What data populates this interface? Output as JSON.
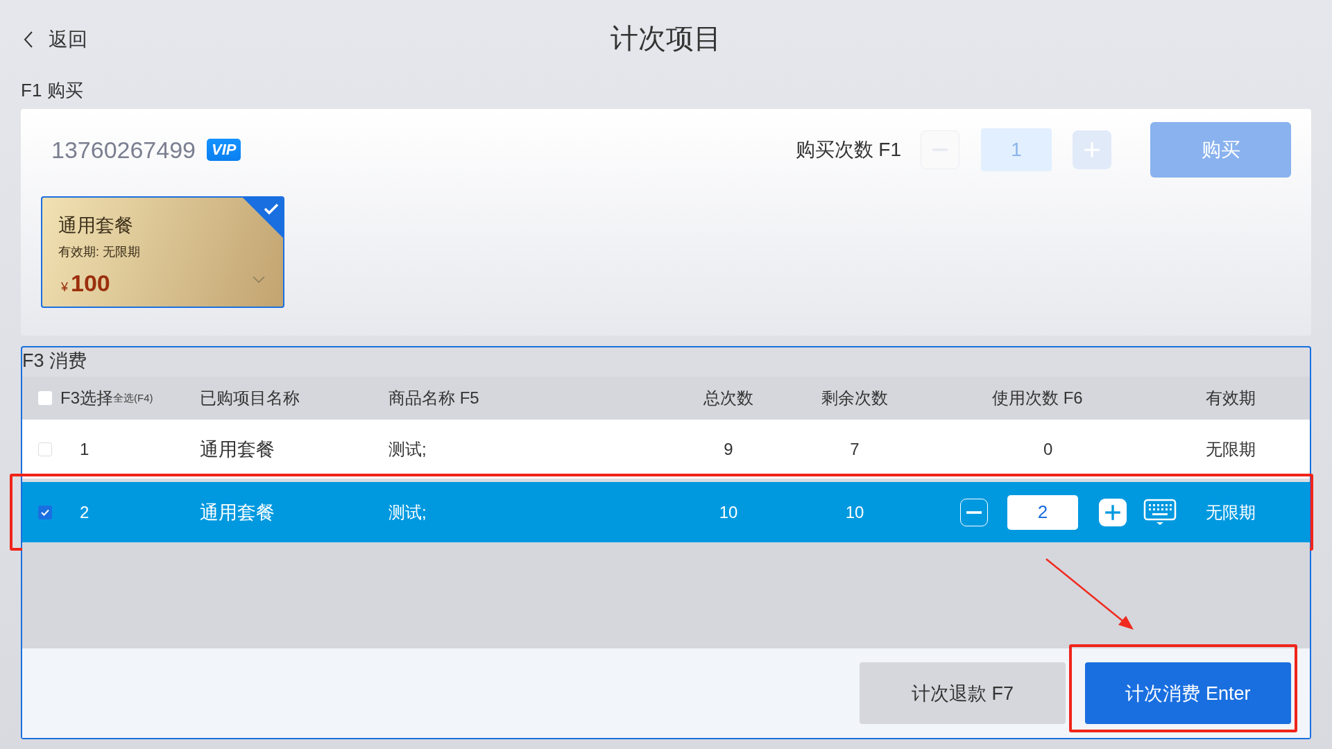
{
  "header": {
    "back": "返回",
    "title": "计次项目"
  },
  "purchase": {
    "section_label": "F1 购买",
    "phone": "13760267499",
    "badge": "VIP",
    "quantity_label": "购买次数 F1",
    "quantity": "1",
    "buy_button": {
      "label": "购买",
      "disabled": true
    },
    "packages": [
      {
        "name": "通用套餐",
        "validity": "有效期: 无限期",
        "currency": "¥",
        "price": "100",
        "selected": true
      }
    ]
  },
  "consume": {
    "section_label": "F3 消费",
    "select_all": {
      "label": "F3选择",
      "hint": "全选(F4)",
      "checked": false
    },
    "columns": [
      "已购项目名称",
      "商品名称 F5",
      "总次数",
      "剩余次数",
      "使用次数 F6",
      "有效期"
    ],
    "rows": [
      {
        "index": "1",
        "name": "通用套餐",
        "product": "测试;",
        "total": "9",
        "remaining": "7",
        "use": "0",
        "validity": "无限期",
        "checked": false,
        "selected": false
      },
      {
        "index": "2",
        "name": "通用套餐",
        "product": "测试;",
        "total": "10",
        "remaining": "10",
        "use": "2",
        "validity": "无限期",
        "checked": true,
        "selected": true
      }
    ],
    "buttons": {
      "refund": "计次退款 F7",
      "consume": "计次消费 Enter"
    }
  }
}
